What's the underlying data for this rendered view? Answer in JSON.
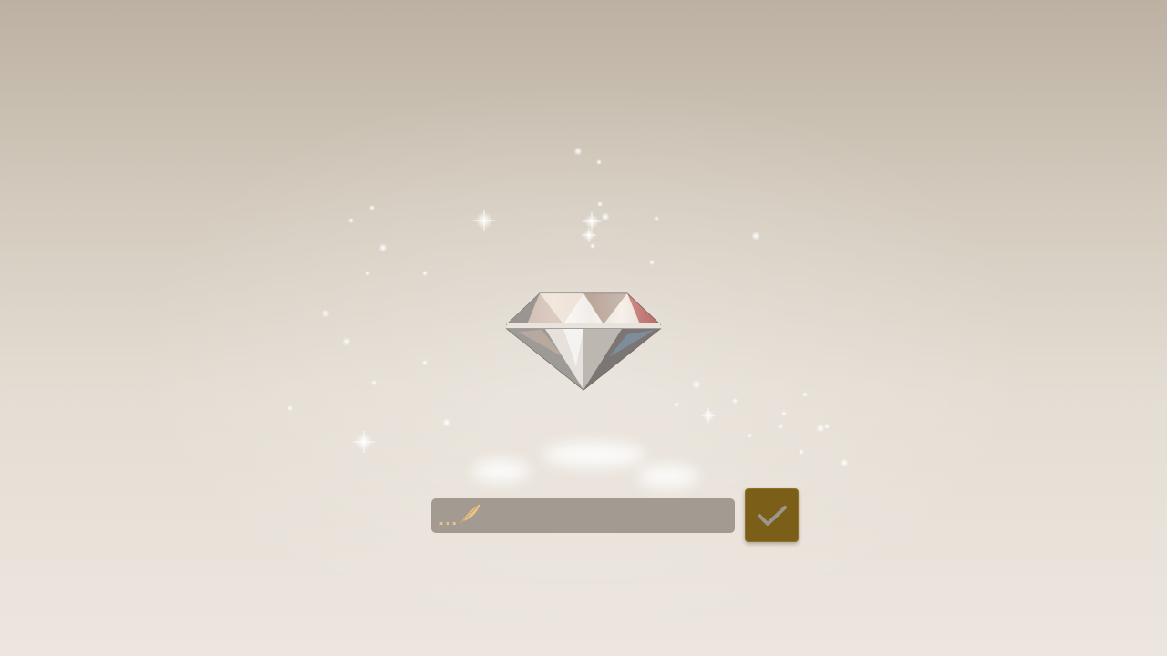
{
  "input": {
    "value": "",
    "prompt_dots": "...",
    "feather_icon": "feather-quill-icon"
  },
  "confirm_button": {
    "icon": "checkmark-icon"
  },
  "colors": {
    "input_bg": "#a39b91",
    "confirm_bg": "#7b5e17",
    "check": "#9c958c",
    "prompt_accent": "#e9c58b"
  }
}
